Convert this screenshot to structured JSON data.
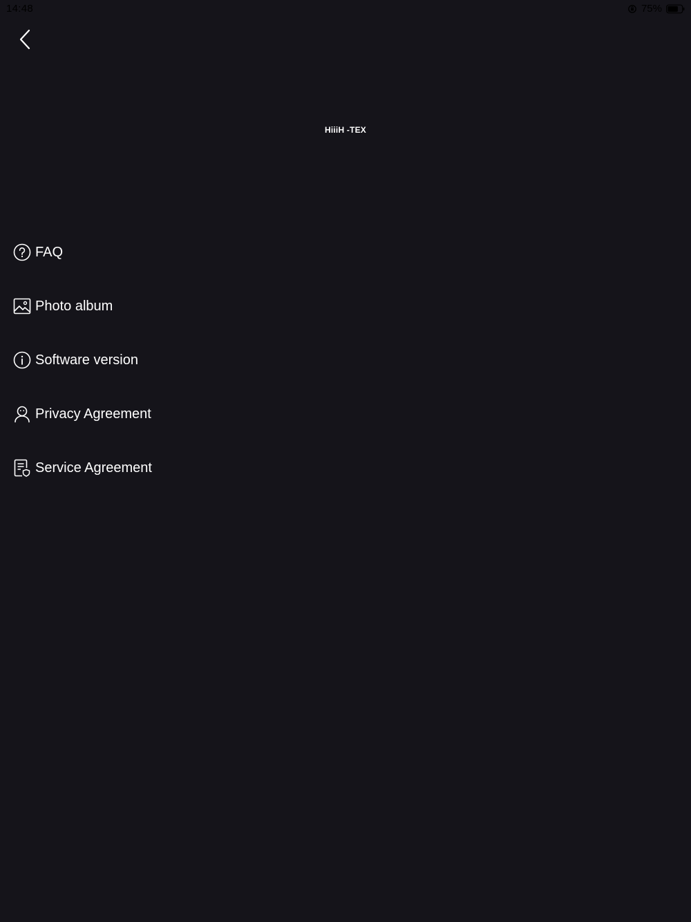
{
  "status_bar": {
    "time": "14:48",
    "battery": "75%"
  },
  "header": {
    "back_icon": "chevron-left-icon",
    "logo": "HiiiH -TEX"
  },
  "menu": {
    "items": [
      {
        "label": "FAQ",
        "icon": "question-circle-icon"
      },
      {
        "label": "Photo album",
        "icon": "image-icon"
      },
      {
        "label": "Software version",
        "icon": "info-circle-icon"
      },
      {
        "label": "Privacy Agreement",
        "icon": "person-icon"
      },
      {
        "label": "Service Agreement",
        "icon": "document-shield-icon"
      }
    ]
  },
  "colors": {
    "background": "#15141a",
    "text": "#ffffff",
    "status_text": "#000000"
  }
}
